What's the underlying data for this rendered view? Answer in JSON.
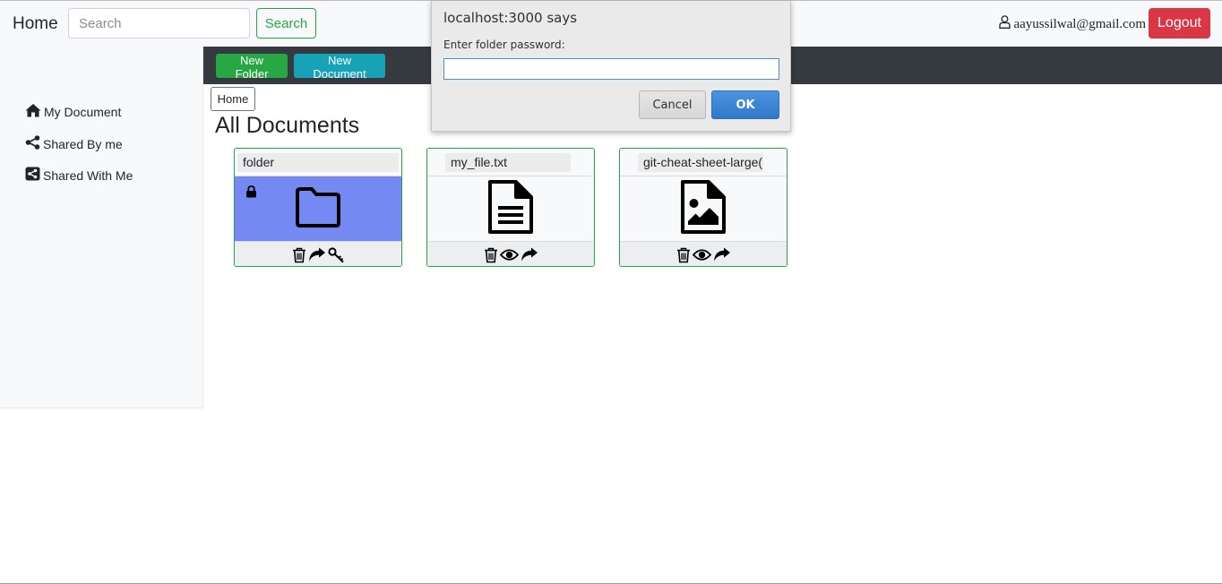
{
  "navbar": {
    "brand": "Home",
    "search_placeholder": "Search",
    "search_button": "Search",
    "user_email": "aayussilwal@gmail.com",
    "logout_button": "Logout"
  },
  "sidebar": {
    "items": [
      {
        "label": "My Document",
        "icon": "home-icon"
      },
      {
        "label": "Shared By me",
        "icon": "share-icon"
      },
      {
        "label": "Shared With Me",
        "icon": "share-square-icon"
      }
    ]
  },
  "toolbar": {
    "new_folder": "New Folder",
    "new_document": "New Document"
  },
  "breadcrumb": {
    "home": "Home"
  },
  "main": {
    "title": "All Documents"
  },
  "cards": [
    {
      "name": "folder",
      "type": "folder",
      "locked": true,
      "actions": [
        "trash-icon",
        "share-arrow-icon",
        "key-icon"
      ]
    },
    {
      "name": "my_file.txt",
      "type": "text-file",
      "locked": false,
      "actions": [
        "trash-icon",
        "eye-icon",
        "share-arrow-icon"
      ]
    },
    {
      "name": "git-cheat-sheet-large(",
      "type": "image-file",
      "locked": false,
      "actions": [
        "trash-icon",
        "eye-icon",
        "share-arrow-icon"
      ]
    }
  ],
  "dialog": {
    "title": "localhost:3000 says",
    "message": "Enter folder password:",
    "input_value": "",
    "cancel": "Cancel",
    "ok": "OK"
  },
  "colors": {
    "success": "#28a745",
    "info": "#17a2b8",
    "danger": "#dc3545",
    "dark": "#343a40",
    "folder_bg": "#7489f1"
  }
}
